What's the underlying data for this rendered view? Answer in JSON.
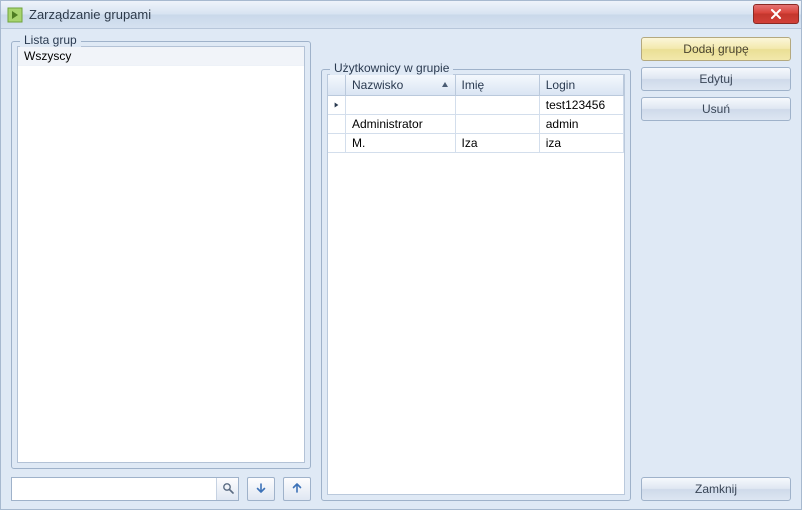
{
  "window": {
    "title": "Zarządzanie grupami",
    "close_label": "Close"
  },
  "left": {
    "legend": "Lista grup",
    "groups": [
      {
        "name": "Wszyscy"
      }
    ],
    "search_placeholder": ""
  },
  "mid": {
    "legend": "Użytkownicy w grupie",
    "columns": {
      "surname": "Nazwisko",
      "name": "Imię",
      "login": "Login"
    },
    "rows": [
      {
        "selected": true,
        "surname": "",
        "name": "",
        "login": "test123456"
      },
      {
        "selected": false,
        "surname": "Administrator",
        "name": "",
        "login": "admin"
      },
      {
        "selected": false,
        "surname": "M.",
        "name": "Iza",
        "login": "iza"
      }
    ]
  },
  "right": {
    "add": "Dodaj grupę",
    "edit": "Edytuj",
    "delete": "Usuń",
    "close": "Zamknij"
  }
}
